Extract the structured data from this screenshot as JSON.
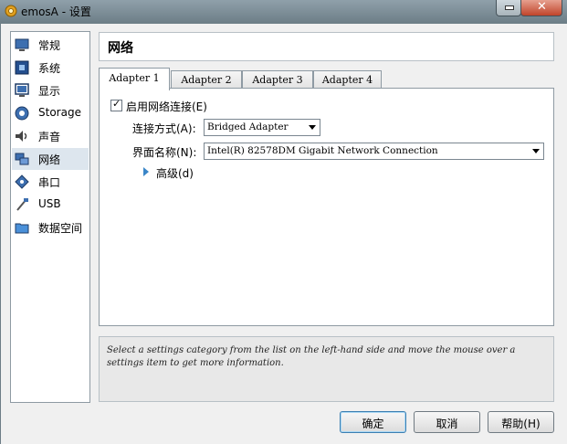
{
  "window": {
    "title": "emosA - 设置",
    "app_icon": "gear-icon"
  },
  "sidebar": {
    "items": [
      {
        "label": "常规",
        "icon": "general-monitor-icon"
      },
      {
        "label": "系统",
        "icon": "system-chip-icon"
      },
      {
        "label": "显示",
        "icon": "display-monitor-icon"
      },
      {
        "label": "Storage",
        "icon": "storage-disk-icon"
      },
      {
        "label": "声音",
        "icon": "speaker-icon"
      },
      {
        "label": "网络",
        "icon": "network-icon",
        "selected": true
      },
      {
        "label": "串口",
        "icon": "serial-port-icon"
      },
      {
        "label": "USB",
        "icon": "usb-icon"
      },
      {
        "label": "数据空间",
        "icon": "shared-folder-icon"
      }
    ]
  },
  "page": {
    "heading": "网络"
  },
  "tabs": [
    {
      "label": "Adapter 1",
      "active": true
    },
    {
      "label": "Adapter 2"
    },
    {
      "label": "Adapter 3"
    },
    {
      "label": "Adapter 4"
    }
  ],
  "adapter": {
    "enable_label": "启用网络连接(E)",
    "enabled": true,
    "attached_to_label": "连接方式(A):",
    "attached_to_value": "Bridged Adapter",
    "name_label": "界面名称(N):",
    "name_value": "Intel(R) 82578DM Gigabit Network Connection",
    "advanced_label": "高级(d)"
  },
  "info": {
    "text": "Select a settings category from the list on the left-hand side and move the mouse over a settings item to get more information."
  },
  "buttons": {
    "ok": "确定",
    "cancel": "取消",
    "help": "帮助(H)"
  },
  "colors": {
    "accent": "#3a86c8",
    "selected_item": "#dde6ee",
    "titlebar": "#7c8d96"
  }
}
